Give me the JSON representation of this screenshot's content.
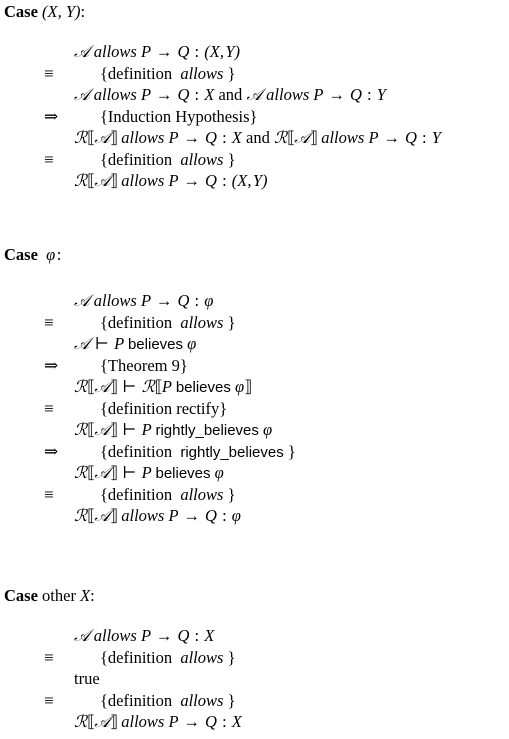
{
  "document": {
    "type": "calculational-proof",
    "title_prefix": "Case",
    "symbols": {
      "equiv": "≡",
      "implies": "⇒",
      "arrow": "→",
      "turnstile": "⊢",
      "lbrack2": "⟦",
      "rbrack2": "⟧",
      "script_r": "ℛ",
      "script_a": "𝒜",
      "phi": "φ",
      "colon": ":"
    }
  },
  "cases": [
    {
      "id": "case-pair",
      "header": {
        "keyword": "Case",
        "subject_math": "(X, Y)",
        "punct": ":"
      },
      "steps": [
        {
          "kind": "expr",
          "rel": "",
          "text": "𝒜 allows P → Q : (X, Y)"
        },
        {
          "kind": "hint",
          "rel": "≡",
          "text": "{definition  allows }"
        },
        {
          "kind": "expr",
          "rel": "",
          "text": "𝒜 allows P → Q : X and 𝒜 allows P → Q : Y"
        },
        {
          "kind": "hint",
          "rel": "⇒",
          "text": "{Induction Hypothesis}"
        },
        {
          "kind": "expr",
          "rel": "",
          "text": "ℛ⟦𝒜⟧ allows P → Q : X and ℛ⟦𝒜⟧ allows P → Q : Y"
        },
        {
          "kind": "hint",
          "rel": "≡",
          "text": "{definition  allows }"
        },
        {
          "kind": "expr",
          "rel": "",
          "text": "ℛ⟦𝒜⟧ allows P → Q : (X, Y)"
        }
      ]
    },
    {
      "id": "case-phi",
      "header": {
        "keyword": "Case",
        "subject_math": "φ",
        "punct": ":"
      },
      "steps": [
        {
          "kind": "expr",
          "rel": "",
          "text": "𝒜 allows P → Q : φ"
        },
        {
          "kind": "hint",
          "rel": "≡",
          "text": "{definition  allows }"
        },
        {
          "kind": "expr",
          "rel": "",
          "text": "𝒜 ⊢ P believes φ"
        },
        {
          "kind": "hint",
          "rel": "⇒",
          "text": "{Theorem 9}"
        },
        {
          "kind": "expr",
          "rel": "",
          "text": "ℛ⟦𝒜⟧ ⊢ ℛ⟦P believes φ⟧"
        },
        {
          "kind": "hint",
          "rel": "≡",
          "text": "{definition rectify}"
        },
        {
          "kind": "expr",
          "rel": "",
          "text": "ℛ⟦𝒜⟧ ⊢ P rightly_believes φ"
        },
        {
          "kind": "hint",
          "rel": "⇒",
          "text": "{definition  rightly_believes }"
        },
        {
          "kind": "expr",
          "rel": "",
          "text": "ℛ⟦𝒜⟧ ⊢ P believes φ"
        },
        {
          "kind": "hint",
          "rel": "≡",
          "text": "{definition  allows }"
        },
        {
          "kind": "expr",
          "rel": "",
          "text": "ℛ⟦𝒜⟧ allows P → Q : φ"
        }
      ]
    },
    {
      "id": "case-other",
      "header": {
        "keyword": "Case",
        "qualifier": "other",
        "subject_math": "X",
        "punct": ":"
      },
      "steps": [
        {
          "kind": "expr",
          "rel": "",
          "text": "𝒜 allows P → Q : X"
        },
        {
          "kind": "hint",
          "rel": "≡",
          "text": "{definition  allows }"
        },
        {
          "kind": "expr",
          "rel": "",
          "text": "true"
        },
        {
          "kind": "hint",
          "rel": "≡",
          "text": "{definition  allows }"
        },
        {
          "kind": "expr",
          "rel": "",
          "text": "ℛ⟦𝒜⟧ allows P → Q : X"
        }
      ]
    }
  ]
}
